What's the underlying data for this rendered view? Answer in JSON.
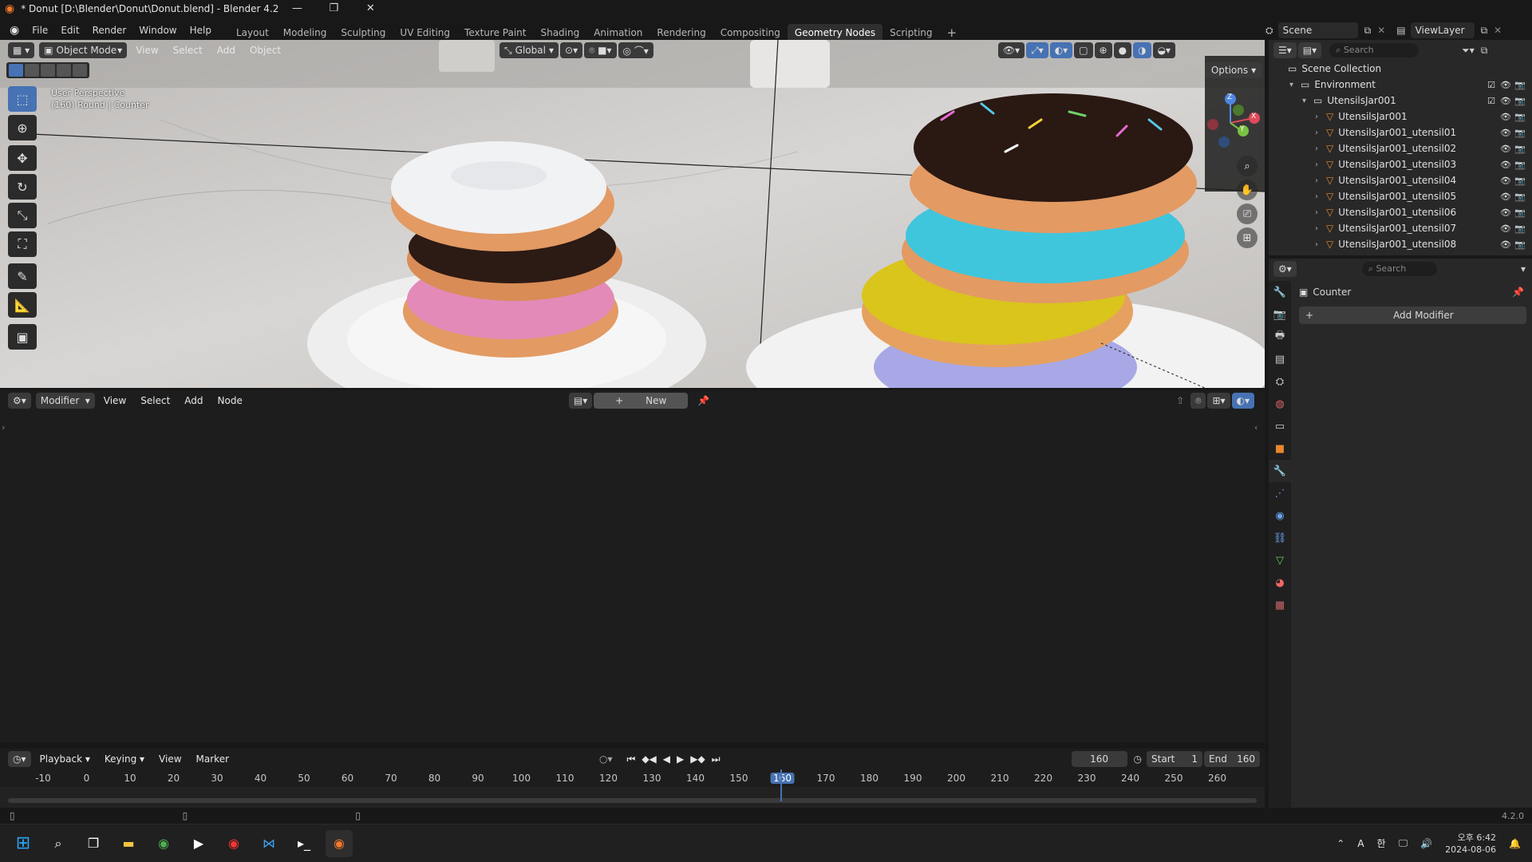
{
  "titlebar": {
    "title": "* Donut [D:\\Blender\\Donut\\Donut.blend] - Blender 4.2",
    "minimize": "—",
    "maximize": "❐",
    "close": "✕"
  },
  "menu": {
    "items": [
      "File",
      "Edit",
      "Render",
      "Window",
      "Help"
    ]
  },
  "workspaces": [
    "Layout",
    "Modeling",
    "Sculpting",
    "UV Editing",
    "Texture Paint",
    "Shading",
    "Animation",
    "Rendering",
    "Compositing",
    "Geometry Nodes",
    "Scripting"
  ],
  "active_workspace": "Geometry Nodes",
  "scene": {
    "name": "Scene",
    "view_layer": "ViewLayer"
  },
  "viewport": {
    "mode": "Object Mode",
    "menus": [
      "View",
      "Select",
      "Add",
      "Object"
    ],
    "transform_orientation": "Global",
    "options_label": "Options",
    "overlay_line1": "User Perspective",
    "overlay_line2": "(160) Round | Counter",
    "gizmo_axes": [
      "Z",
      "X",
      "Y"
    ]
  },
  "node_editor": {
    "type": "Modifier",
    "menus": [
      "View",
      "Select",
      "Add",
      "Node"
    ],
    "new_label": "New"
  },
  "timeline": {
    "menus": [
      "Playback",
      "Keying",
      "View",
      "Marker"
    ],
    "current_frame": 160,
    "start_label": "Start",
    "start": 1,
    "end_label": "End",
    "end": 160,
    "ticks": [
      -10,
      0,
      10,
      20,
      30,
      40,
      50,
      60,
      70,
      80,
      90,
      100,
      110,
      120,
      130,
      140,
      150,
      160,
      170,
      180,
      190,
      200,
      210,
      220,
      230,
      240,
      250,
      260
    ]
  },
  "outliner": {
    "search_placeholder": "Search",
    "items": [
      {
        "label": "Scene Collection",
        "depth": 0
      },
      {
        "label": "Environment",
        "depth": 1
      },
      {
        "label": "UtensilsJar001",
        "depth": 2
      },
      {
        "label": "UtensilsJar001",
        "depth": 3
      },
      {
        "label": "UtensilsJar001_utensil01",
        "depth": 3
      },
      {
        "label": "UtensilsJar001_utensil02",
        "depth": 3
      },
      {
        "label": "UtensilsJar001_utensil03",
        "depth": 3
      },
      {
        "label": "UtensilsJar001_utensil04",
        "depth": 3
      },
      {
        "label": "UtensilsJar001_utensil05",
        "depth": 3
      },
      {
        "label": "UtensilsJar001_utensil06",
        "depth": 3
      },
      {
        "label": "UtensilsJar001_utensil07",
        "depth": 3
      },
      {
        "label": "UtensilsJar001_utensil08",
        "depth": 3
      }
    ]
  },
  "properties": {
    "search_placeholder": "Search",
    "object_name": "Counter",
    "add_modifier": "Add Modifier"
  },
  "statusbar": {
    "version": "4.2.0"
  },
  "taskbar": {
    "ime_mode": "A",
    "ime_lang": "한",
    "time": "오후 6:42",
    "date": "2024-08-06"
  },
  "colors": {
    "accent": "#4772b3",
    "active_tool": "#4772b3",
    "object_orange": "#e8872b"
  }
}
